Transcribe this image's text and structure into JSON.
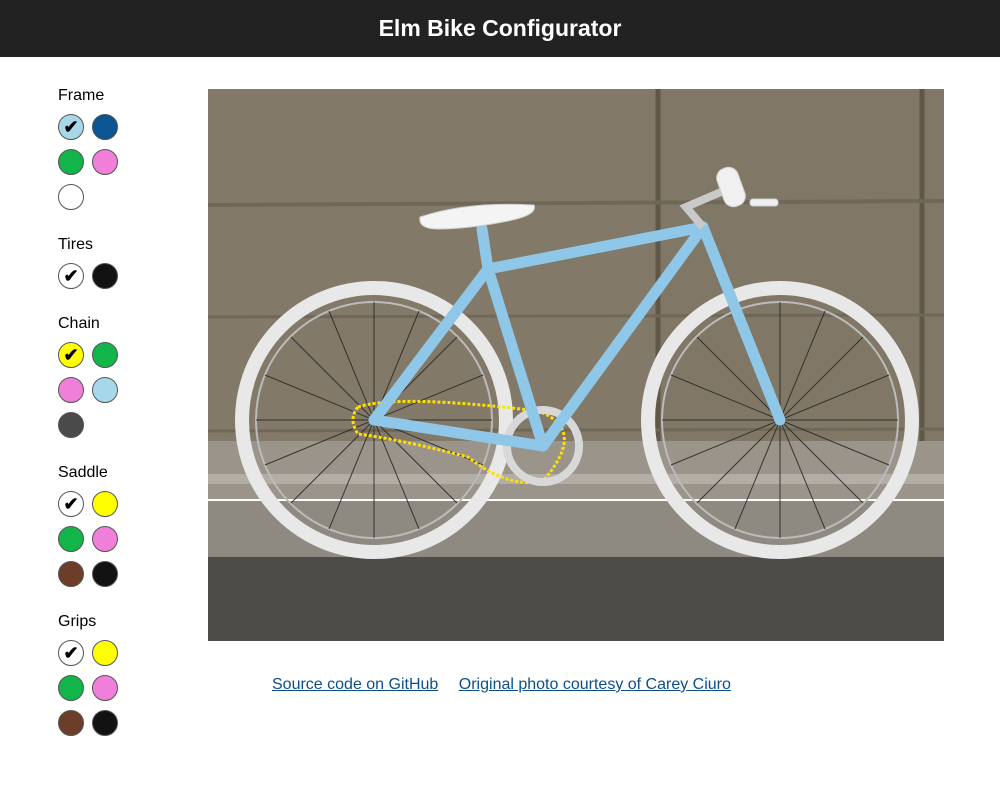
{
  "header": {
    "title": "Elm Bike Configurator"
  },
  "options": [
    {
      "label": "Frame",
      "colors": [
        "#a7d8ea",
        "#0b5593",
        "#11b54a",
        "#ef7fd9",
        "#ffffff"
      ],
      "selected": 0
    },
    {
      "label": "Tires",
      "colors": [
        "#ffffff",
        "#121212"
      ],
      "selected": 0
    },
    {
      "label": "Chain",
      "colors": [
        "#ffff00",
        "#11b54a",
        "#ef7fd9",
        "#a7d8ea",
        "#4a4a4a"
      ],
      "selected": 0
    },
    {
      "label": "Saddle",
      "colors": [
        "#ffffff",
        "#ffff00",
        "#11b54a",
        "#ef7fd9",
        "#6c3e29",
        "#121212"
      ],
      "selected": 0
    },
    {
      "label": "Grips",
      "colors": [
        "#ffffff",
        "#ffff00",
        "#11b54a",
        "#ef7fd9",
        "#6c3e29",
        "#121212"
      ],
      "selected": 0
    }
  ],
  "links": {
    "source": "Source code on GitHub",
    "photo": "Original photo courtesy of Carey Ciuro"
  },
  "photo_colors": {
    "frame": "#8ec7e8",
    "chain": "#ffe000",
    "saddle": "#f4f4f4",
    "tires": "#e8e8e8",
    "grips": "#f0f0f0"
  }
}
